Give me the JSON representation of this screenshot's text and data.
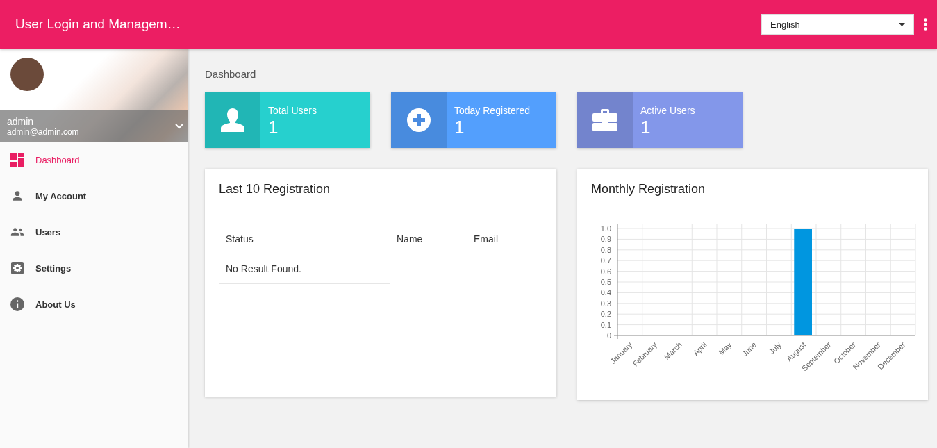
{
  "header": {
    "title": "User Login and Managem…",
    "language": {
      "value": "English"
    }
  },
  "sidebar": {
    "profile": {
      "name": "admin",
      "email": "admin@admin.com"
    },
    "items": [
      {
        "label": "Dashboard",
        "kind": "dashboard",
        "selected": true
      },
      {
        "label": "My Account",
        "kind": "person",
        "selected": false
      },
      {
        "label": "Users",
        "kind": "people",
        "selected": false
      },
      {
        "label": "Settings",
        "kind": "gear",
        "selected": false
      },
      {
        "label": "About Us",
        "kind": "info",
        "selected": false
      }
    ]
  },
  "breadcrumb": "Dashboard",
  "stats": [
    {
      "label": "Total Users",
      "value": "1",
      "kind": "person",
      "color": "#26d0ce"
    },
    {
      "label": "Today Registered",
      "value": "1",
      "kind": "plus",
      "color": "#539ffd"
    },
    {
      "label": "Active Users",
      "value": "1",
      "kind": "briefcase",
      "color": "#8397ea"
    }
  ],
  "registrations": {
    "title": "Last 10 Registration",
    "columns": [
      "Status",
      "Name",
      "Email"
    ],
    "empty_message": "No Result Found."
  },
  "monthly": {
    "title": "Monthly Registration",
    "chart_data": {
      "type": "bar",
      "categories": [
        "January",
        "February",
        "March",
        "April",
        "May",
        "June",
        "July",
        "August",
        "September",
        "October",
        "November",
        "December"
      ],
      "grid": true,
      "series": [
        {
          "color": "#0096e0",
          "values": [
            0,
            0,
            0,
            0,
            0,
            0,
            0,
            1,
            0,
            0,
            0,
            0
          ]
        }
      ],
      "ylim": [
        0,
        1
      ],
      "yticks": [
        {
          "value": 0,
          "label": "0"
        },
        {
          "value": 0.1,
          "label": "0.1"
        },
        {
          "value": 0.2,
          "label": "0.2"
        },
        {
          "value": 0.3,
          "label": "0.3"
        },
        {
          "value": 0.4,
          "label": "0.4"
        },
        {
          "value": 0.5,
          "label": "0.5"
        },
        {
          "value": 0.6,
          "label": "0.6"
        },
        {
          "value": 0.7,
          "label": "0.7"
        },
        {
          "value": 0.8,
          "label": "0.8"
        },
        {
          "value": 0.9,
          "label": "0.9"
        },
        {
          "value": 1,
          "label": "1.0"
        }
      ]
    }
  }
}
